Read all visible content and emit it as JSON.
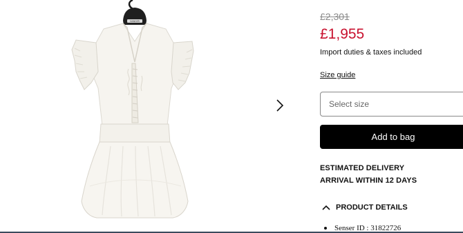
{
  "product": {
    "old_price": "£2,301",
    "price": "£1,955",
    "duties_note": "Import duties & taxes included",
    "size_guide_label": "Size guide",
    "size_placeholder": "Select size",
    "add_to_bag_label": "Add to bag",
    "delivery_line1": "ESTIMATED DELIVERY",
    "delivery_line2": "ARRIVAL WITHIN 12 DAYS",
    "details_heading": "PRODUCT DETAILS",
    "spec_items": [
      "Senser ID : 31822726"
    ],
    "hanger_tag": "HANGER"
  },
  "colors": {
    "price_red": "#c8102e",
    "button_black": "#000000",
    "old_price_grey": "#8a8a8a"
  },
  "icons": {
    "gallery_next": "chevron-right-icon",
    "details_toggle": "chevron-up-icon"
  }
}
